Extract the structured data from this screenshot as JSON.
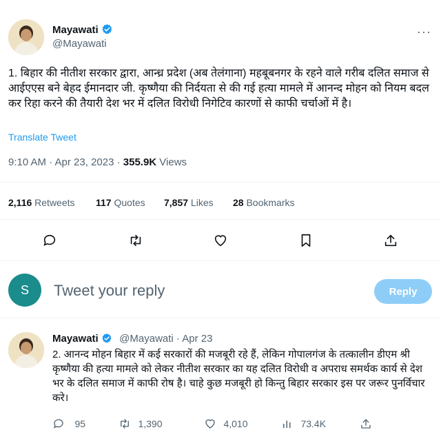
{
  "tweet": {
    "author_name": "Mayawati",
    "author_handle": "@Mayawati",
    "more_label": "···",
    "text": "1. बिहार की नीतीश सरकार द्वारा, आन्ध्र प्रदेश (अब तेलंगाना) महबूबनगर के रहने वाले गरीब दलित समाज से आईएएस बने बेहद ईमानदार जी. कृष्णैया की निर्दयता से की गई हत्या मामले में आनन्द मोहन को नियम बदल कर रिहा करने की तैयारी देश भर में दलित विरोधी निगेटिव कारणों से काफी चर्चाओं में है।",
    "translate_label": "Translate Tweet",
    "time": "9:10 AM · Apr 23, 2023 · ",
    "views_count": "355.9K",
    "views_label": " Views",
    "stats": {
      "retweets_count": "2,116",
      "retweets_label": " Retweets",
      "quotes_count": "117",
      "quotes_label": " Quotes",
      "likes_count": "7,857",
      "likes_label": " Likes",
      "bookmarks_count": "28",
      "bookmarks_label": " Bookmarks"
    }
  },
  "reply_box": {
    "avatar_letter": "S",
    "placeholder": "Tweet your reply",
    "button_label": "Reply"
  },
  "reply_tweet": {
    "author_name": "Mayawati",
    "author_handle_date": "@Mayawati · Apr 23",
    "text": "2. आनन्द मोहन बिहार में कई सरकारों की मजबूरी रहे हैं, लेकिन गोपालगंज के तत्कालीन डीएम श्री कृष्णैया की हत्या मामले को लेकर नीतीश सरकार का यह दलित विरोधी व अपराध समर्थक कार्य से देश भर के दलित समाज में काफी रोष है। चाहे कुछ मजबूरी हो किन्तु बिहार सरकार इस पर जरूर पुनर्विचार करे।",
    "replies": "95",
    "retweets": "1,390",
    "likes": "4,010",
    "views": "73.4K"
  },
  "colors": {
    "accent": "#1d9bf0",
    "secondary_text": "#536471",
    "reply_button": "#8ecdf8",
    "reply_avatar": "#1a8c8c"
  },
  "icons": [
    "verified-badge-icon",
    "more-icon",
    "reply-icon",
    "retweet-icon",
    "like-icon",
    "bookmark-icon",
    "share-icon",
    "views-icon"
  ]
}
